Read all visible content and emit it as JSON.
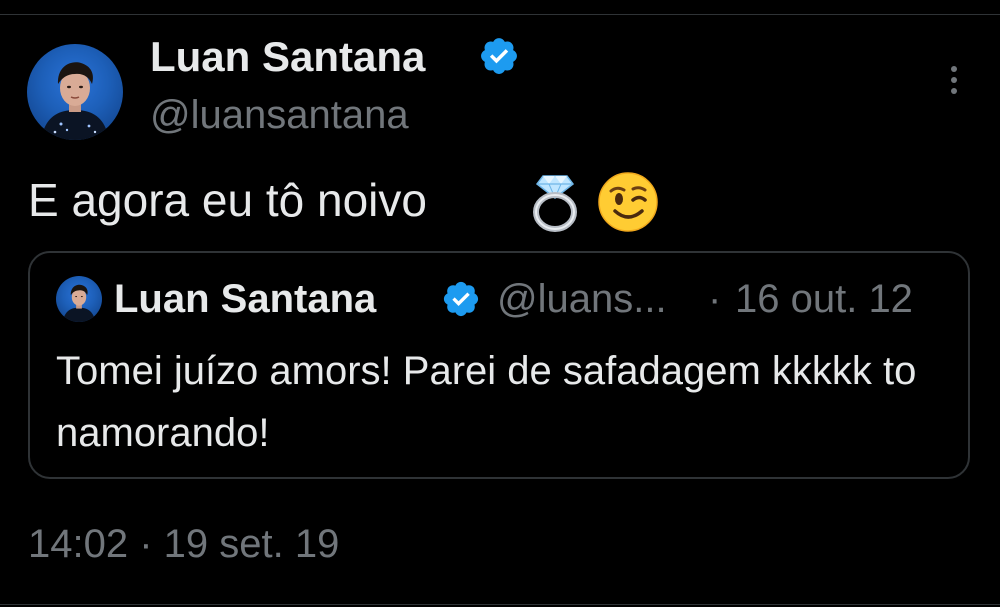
{
  "tweet": {
    "author": {
      "name": "Luan Santana",
      "handle": "@luansantana",
      "verified": true,
      "avatar": "profile-photo"
    },
    "text": "E agora eu tô noivo",
    "emojis": [
      "ring-emoji",
      "winking-face-emoji"
    ],
    "more_icon": "more-vertical-icon",
    "timestamp": "14:02 · 19 set. 19"
  },
  "quoted_tweet": {
    "author": {
      "name": "Luan Santana",
      "handle": "@luans...",
      "verified": true
    },
    "separator": "·",
    "date": "16 out. 12",
    "text": "Tomei juízo amors! Parei de safadagem kkkkk to namorando!"
  },
  "colors": {
    "background": "#000000",
    "primary_text": "#e7e9ea",
    "secondary_text": "#71767b",
    "border": "#2f3336",
    "verified_blue": "#1d9bf0"
  }
}
